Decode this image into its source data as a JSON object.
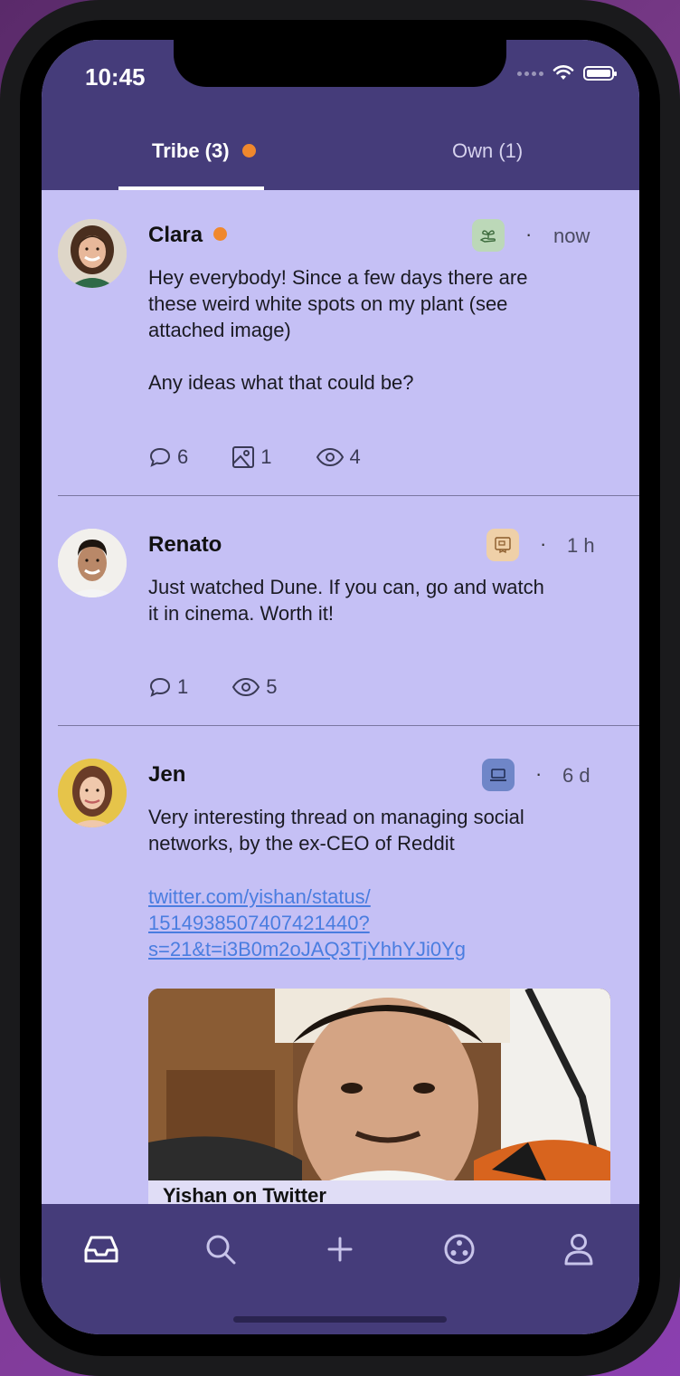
{
  "status_bar": {
    "time": "10:45"
  },
  "tabs": [
    {
      "label": "Tribe (3)",
      "active": true,
      "has_notification": true
    },
    {
      "label": "Own (1)",
      "active": false,
      "has_notification": false
    }
  ],
  "posts": [
    {
      "author": "Clara",
      "online": true,
      "tag_icon": "plant-hand-icon",
      "tag_color": "#bcd8b8",
      "separator": "·",
      "time_ago": "now",
      "text_lines": [
        "Hey everybody! Since a few days there are",
        "these weird white spots on my plant (see",
        "attached image)",
        "",
        "Any ideas what that could be?"
      ],
      "stats": {
        "comments": "6",
        "images": "1",
        "views": "4"
      }
    },
    {
      "author": "Renato",
      "online": false,
      "tag_icon": "movie-ticket-icon",
      "tag_color": "#efd0a8",
      "separator": "·",
      "time_ago": "1 h",
      "text_lines": [
        "Just watched Dune. If you can, go and watch",
        "it in cinema. Worth it!"
      ],
      "stats": {
        "comments": "1",
        "views": "5"
      }
    },
    {
      "author": "Jen",
      "online": false,
      "tag_icon": "laptop-icon",
      "tag_color": "#6f86c8",
      "separator": "·",
      "time_ago": "6 d",
      "text_lines": [
        "Very interesting thread on managing social",
        "networks, by the ex-CEO of Reddit"
      ],
      "link_lines": [
        "twitter.com/yishan/status/",
        "1514938507407421440?",
        "s=21&t=i3B0m2oJAQ3TjYhhYJi0Yg"
      ],
      "link_card_title": "Yishan on Twitter"
    }
  ],
  "bottom_nav": [
    {
      "icon": "inbox-icon",
      "active": true
    },
    {
      "icon": "search-icon",
      "active": false
    },
    {
      "icon": "plus-icon",
      "active": false
    },
    {
      "icon": "tribes-icon",
      "active": false
    },
    {
      "icon": "profile-icon",
      "active": false
    }
  ],
  "colors": {
    "header_bg": "#453c7a",
    "feed_bg": "#c5c0f5",
    "accent_orange": "#f0882d",
    "link_blue": "#4a7de0"
  }
}
